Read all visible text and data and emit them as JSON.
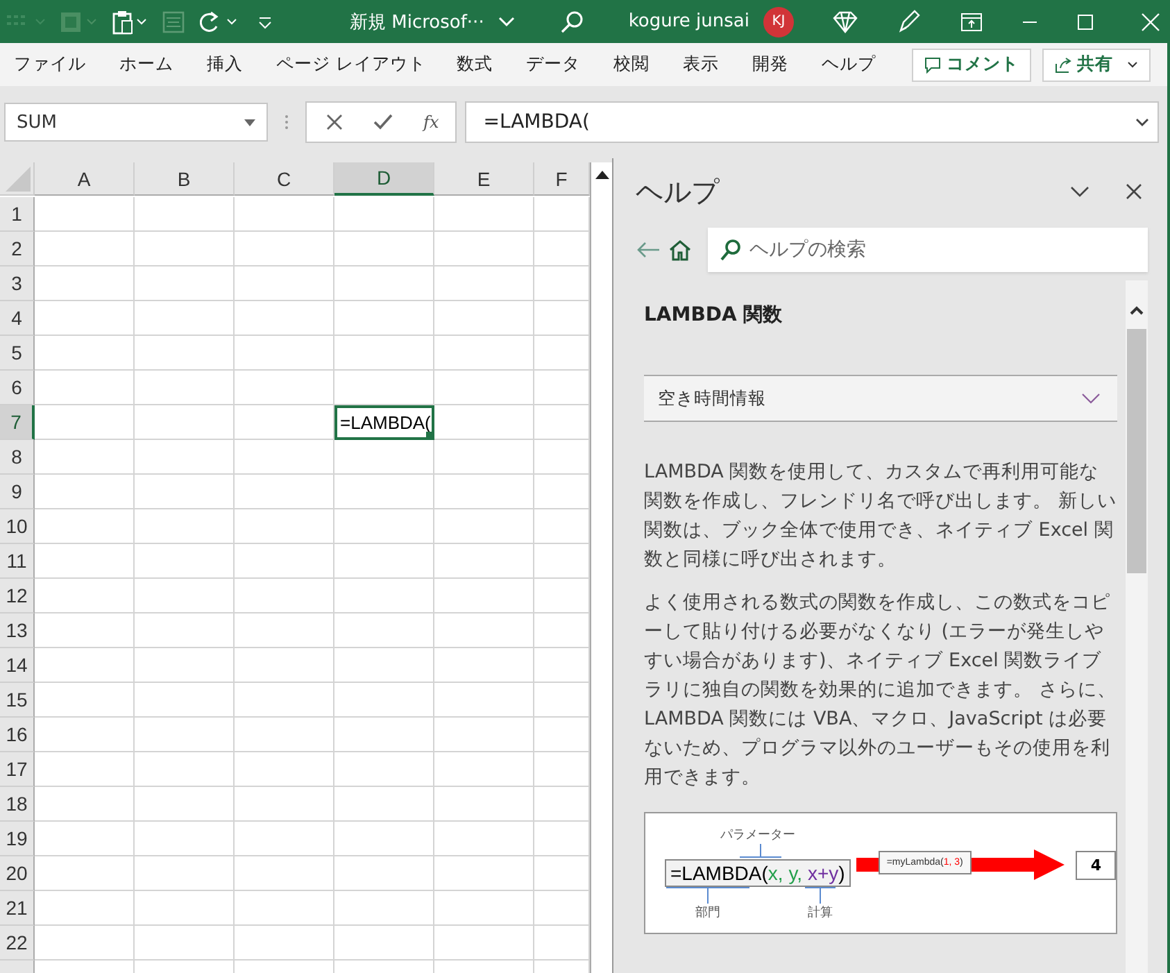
{
  "title_bar": {
    "title": "新規 Microsof···",
    "user": "kogure junsai",
    "avatar": "KJ"
  },
  "ribbon": {
    "tabs": [
      "ファイル",
      "ホーム",
      "挿入",
      "ページ レイアウト",
      "数式",
      "データ",
      "校閲",
      "表示",
      "開発",
      "ヘルプ"
    ],
    "comment_button": "コメント",
    "share_button": "共有"
  },
  "formula_bar": {
    "name_box": "SUM",
    "fx": "fx",
    "formula": "=LAMBDA("
  },
  "sheet": {
    "columns": [
      {
        "label": "A",
        "selected": false
      },
      {
        "label": "B",
        "selected": false
      },
      {
        "label": "C",
        "selected": false
      },
      {
        "label": "D",
        "selected": true
      },
      {
        "label": "E",
        "selected": false
      },
      {
        "label": "F",
        "selected": false
      }
    ],
    "rows": [
      {
        "label": "1",
        "selected": false
      },
      {
        "label": "2",
        "selected": false
      },
      {
        "label": "3",
        "selected": false
      },
      {
        "label": "4",
        "selected": false
      },
      {
        "label": "5",
        "selected": false
      },
      {
        "label": "6",
        "selected": false
      },
      {
        "label": "7",
        "selected": true
      },
      {
        "label": "8",
        "selected": false
      },
      {
        "label": "9",
        "selected": false
      },
      {
        "label": "10",
        "selected": false
      },
      {
        "label": "11",
        "selected": false
      },
      {
        "label": "12",
        "selected": false
      },
      {
        "label": "13",
        "selected": false
      },
      {
        "label": "14",
        "selected": false
      },
      {
        "label": "15",
        "selected": false
      },
      {
        "label": "16",
        "selected": false
      },
      {
        "label": "17",
        "selected": false
      },
      {
        "label": "18",
        "selected": false
      },
      {
        "label": "19",
        "selected": false
      },
      {
        "label": "20",
        "selected": false
      },
      {
        "label": "21",
        "selected": false
      },
      {
        "label": "22",
        "selected": false
      }
    ],
    "active_cell": {
      "value": "=LAMBDA("
    }
  },
  "help_pane": {
    "title": "ヘルプ",
    "search": {
      "placeholder": "ヘルプの検索"
    },
    "article_title": "LAMBDA 関数",
    "section": {
      "label": "空き時間情報",
      "expanded": false
    },
    "paragraphs": [
      "LAMBDA 関数を使用して、カスタムで再利用可能な関数を作成し、フレンドリ名で呼び出します。 新しい関数は、ブック全体で使用でき、ネイティブ Excel 関数と同様に呼び出されます。",
      "よく使用される数式の関数を作成し、この数式をコピーして貼り付ける必要がなくなり (エラーが発生しやすい場合があります)、ネイティブ Excel 関数ライブラリに独自の関数を効果的に追加できます。 さらに、LAMBDA 関数には VBA、マクロ、JavaScript は必要ないため、プログラマ以外のユーザーもその使用を利用できます。"
    ],
    "diagram": {
      "parameter_label": "パラメーター",
      "formula_parts": [
        {
          "text": "=LAMBDA(",
          "color": "#000000"
        },
        {
          "text": "x, y, ",
          "color": "#22a04b"
        },
        {
          "text": "x+y",
          "color": "#7030a0"
        },
        {
          "text": ")",
          "color": "#000000"
        }
      ],
      "call_parts": [
        {
          "text": "=myLambda(",
          "color": "#333333"
        },
        {
          "text": "1, 3",
          "color": "#ff0000"
        },
        {
          "text": ")",
          "color": "#333333"
        }
      ],
      "result": "4",
      "left_label": "部門",
      "right_label": "計算"
    }
  }
}
